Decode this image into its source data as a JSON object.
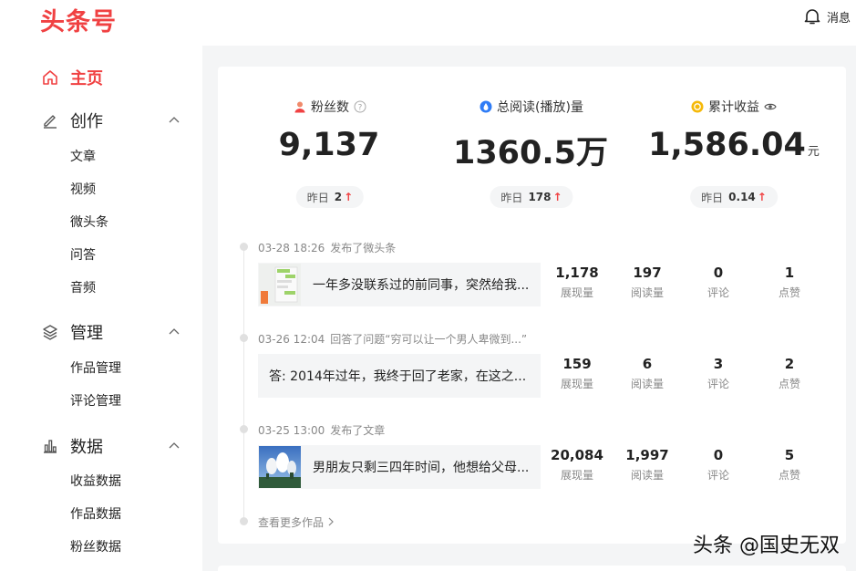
{
  "header": {
    "logo": "头条号",
    "message_label": "消息"
  },
  "sidebar": {
    "home": "主页",
    "create": {
      "label": "创作",
      "items": [
        "文章",
        "视频",
        "微头条",
        "问答",
        "音频"
      ]
    },
    "manage": {
      "label": "管理",
      "items": [
        "作品管理",
        "评论管理"
      ]
    },
    "data": {
      "label": "数据",
      "items": [
        "收益数据",
        "作品数据",
        "粉丝数据"
      ]
    }
  },
  "stats": [
    {
      "label": "粉丝数",
      "value": "9,137",
      "unit": "",
      "yesterday_label": "昨日",
      "yesterday_value": "2"
    },
    {
      "label": "总阅读(播放)量",
      "value": "1360.5万",
      "unit": "",
      "yesterday_label": "昨日",
      "yesterday_value": "178"
    },
    {
      "label": "累计收益",
      "value": "1,586.04",
      "unit": "元",
      "yesterday_label": "昨日",
      "yesterday_value": "0.14"
    }
  ],
  "entries": [
    {
      "time": "03-28 18:26",
      "action": "发布了微头条",
      "text": "一年多没联系过的前同事，突然给我...",
      "metrics": [
        {
          "value": "1,178",
          "label": "展现量"
        },
        {
          "value": "197",
          "label": "阅读量"
        },
        {
          "value": "0",
          "label": "评论"
        },
        {
          "value": "1",
          "label": "点赞"
        }
      ]
    },
    {
      "time": "03-26 12:04",
      "action": "回答了问题“穷可以让一个男人卑微到...”",
      "text": "答: 2014年过年，我终于回了老家，在这之...",
      "metrics": [
        {
          "value": "159",
          "label": "展现量"
        },
        {
          "value": "6",
          "label": "阅读量"
        },
        {
          "value": "3",
          "label": "评论"
        },
        {
          "value": "2",
          "label": "点赞"
        }
      ]
    },
    {
      "time": "03-25 13:00",
      "action": "发布了文章",
      "text": "男朋友只剩三四年时间，他想给父母...",
      "metrics": [
        {
          "value": "20,084",
          "label": "展现量"
        },
        {
          "value": "1,997",
          "label": "阅读量"
        },
        {
          "value": "0",
          "label": "评论"
        },
        {
          "value": "5",
          "label": "点赞"
        }
      ]
    }
  ],
  "more_label": "查看更多作品",
  "watermark": "头条 @国史无双",
  "colors": {
    "accent": "#f04142",
    "blue": "#2f7cf6",
    "gold": "#f5b90a"
  }
}
